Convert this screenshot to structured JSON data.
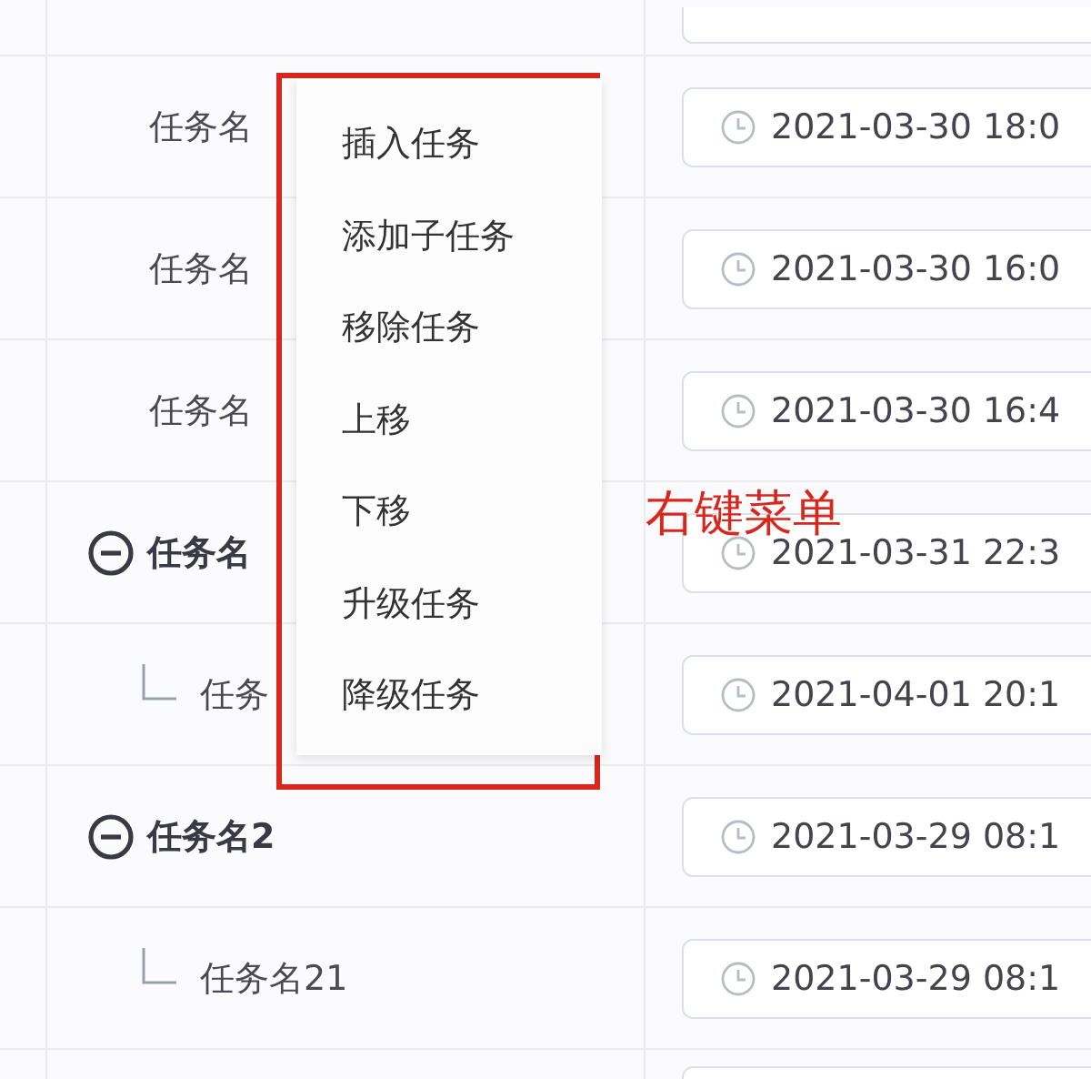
{
  "tasks": [
    {
      "kind": "plain",
      "name": "任务名",
      "date": "2021-03-30 18:0"
    },
    {
      "kind": "plain",
      "name": "任务名",
      "date": "2021-03-30 16:0"
    },
    {
      "kind": "plain",
      "name": "任务名",
      "date": "2021-03-30 16:4"
    },
    {
      "kind": "group",
      "name": "任务名",
      "expanded": true,
      "date": "2021-03-31 22:3",
      "children": [
        {
          "kind": "leaf",
          "name": "任务",
          "date": "2021-04-01 20:1"
        }
      ]
    },
    {
      "kind": "group",
      "name": "任务名2",
      "expanded": true,
      "date": "2021-03-29 08:1",
      "children": [
        {
          "kind": "leaf",
          "name": "任务名21",
          "date": "2021-03-29 08:1"
        }
      ]
    }
  ],
  "context_menu": [
    "插入任务",
    "添加子任务",
    "移除任务",
    "上移",
    "下移",
    "升级任务",
    "降级任务"
  ],
  "annotation": "右键菜单"
}
